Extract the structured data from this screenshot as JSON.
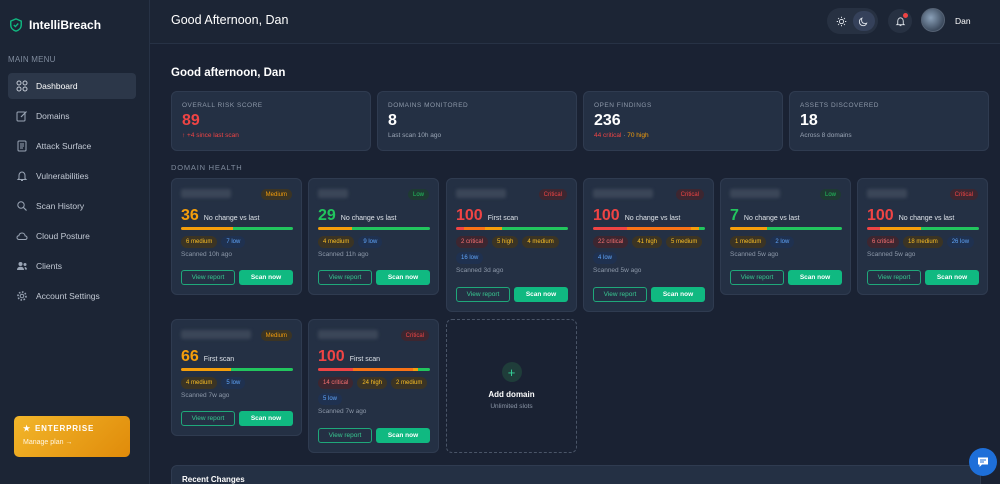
{
  "app": {
    "name": "IntelliBreach"
  },
  "sidebar": {
    "menu_title": "MAIN MENU",
    "items": [
      {
        "label": "Dashboard",
        "icon": "grid-icon",
        "active": true
      },
      {
        "label": "Domains",
        "icon": "pencil-icon"
      },
      {
        "label": "Attack Surface",
        "icon": "document-icon"
      },
      {
        "label": "Vulnerabilities",
        "icon": "bell-icon"
      },
      {
        "label": "Scan History",
        "icon": "scan-icon"
      },
      {
        "label": "Cloud Posture",
        "icon": "cloud-icon"
      },
      {
        "label": "Clients",
        "icon": "users-icon"
      },
      {
        "label": "Account Settings",
        "icon": "gear-icon"
      }
    ],
    "plan": {
      "title": "ENTERPRISE",
      "link": "Manage plan →"
    }
  },
  "header": {
    "greeting": "Good Afternoon, Dan",
    "user_name": "Dan"
  },
  "main": {
    "greeting": "Good afternoon, Dan",
    "stats": [
      {
        "label": "OVERALL RISK SCORE",
        "value": "89",
        "sub": "↑ +4 since last scan"
      },
      {
        "label": "DOMAINS MONITORED",
        "value": "8",
        "sub": "Last scan 10h ago"
      },
      {
        "label": "OPEN FINDINGS",
        "value": "236",
        "sub_critical": "44 critical",
        "sub_sep": " · ",
        "sub_high": "70 high"
      },
      {
        "label": "ASSETS DISCOVERED",
        "value": "18",
        "sub": "Across 8 domains"
      }
    ],
    "section_title": "DOMAIN HEALTH",
    "domains": [
      {
        "badge": "Medium",
        "score": "36",
        "change": "No change vs last",
        "chips": [
          "6 medium",
          "7 low"
        ],
        "scanned": "Scanned 10h ago",
        "view": "View report",
        "scan": "Scan now"
      },
      {
        "badge": "Low",
        "score": "29",
        "change": "No change vs last",
        "chips": [
          "4 medium",
          "9 low"
        ],
        "scanned": "Scanned 11h ago",
        "view": "View report",
        "scan": "Scan now"
      },
      {
        "badge": "Critical",
        "score": "100",
        "change": "First scan",
        "chips": [
          "2 critical",
          "5 high",
          "4 medium",
          "16 low"
        ],
        "scanned": "Scanned 3d ago",
        "view": "View report",
        "scan": "Scan now"
      },
      {
        "badge": "Critical",
        "score": "100",
        "change": "No change vs last",
        "chips": [
          "22 critical",
          "41 high",
          "5 medium",
          "4 low"
        ],
        "scanned": "Scanned 5w ago",
        "view": "View report",
        "scan": "Scan now"
      },
      {
        "badge": "Low",
        "score": "7",
        "change": "No change vs last",
        "chips": [
          "1 medium",
          "2 low"
        ],
        "scanned": "Scanned 5w ago",
        "view": "View report",
        "scan": "Scan now"
      },
      {
        "badge": "Critical",
        "score": "100",
        "change": "No change vs last",
        "chips": [
          "6 critical",
          "18 medium",
          "26 low"
        ],
        "scanned": "Scanned 5w ago",
        "view": "View report",
        "scan": "Scan now"
      },
      {
        "badge": "Medium",
        "score": "66",
        "change": "First scan",
        "chips": [
          "4 medium",
          "5 low"
        ],
        "scanned": "Scanned 7w ago",
        "view": "View report",
        "scan": "Scan now"
      },
      {
        "badge": "Critical",
        "score": "100",
        "change": "First scan",
        "chips": [
          "14 critical",
          "24 high",
          "2 medium",
          "5 low"
        ],
        "scanned": "Scanned 7w ago",
        "view": "View report",
        "scan": "Scan now"
      }
    ],
    "add_domain": {
      "title": "Add domain",
      "sub": "Unlimited slots"
    },
    "recent_title": "Recent Changes"
  },
  "colors": {
    "accent": "#10b981",
    "critical": "#ef4444",
    "high": "#f59e0b",
    "low": "#22c55e",
    "info": "#60a5fa"
  }
}
